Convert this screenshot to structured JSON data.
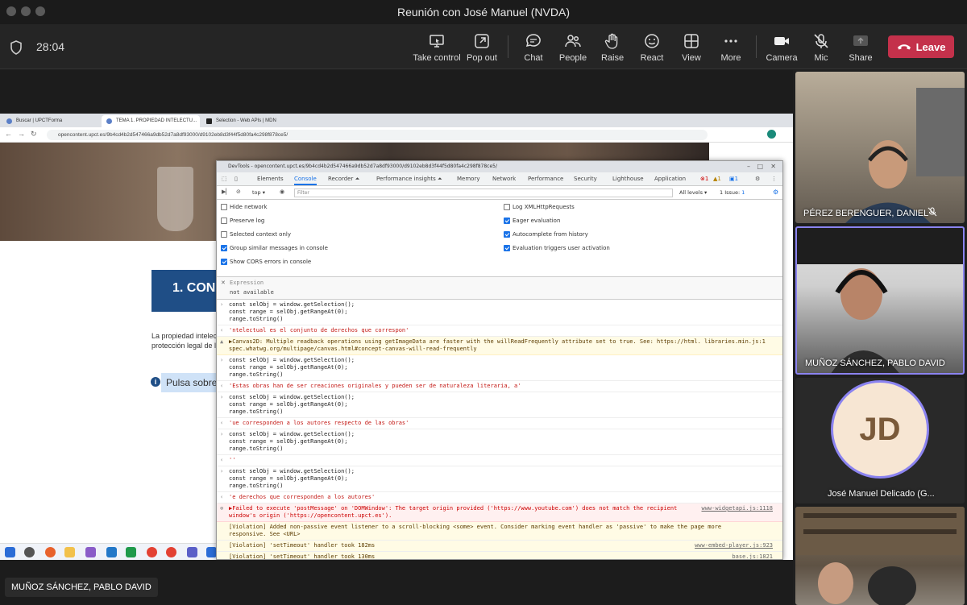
{
  "window": {
    "title": "Reunión con José Manuel (NVDA)"
  },
  "toolbar": {
    "timer": "28:04",
    "take_control": "Take control",
    "pop_out": "Pop out",
    "chat": "Chat",
    "people": "People",
    "raise": "Raise",
    "react": "React",
    "view": "View",
    "more": "More",
    "camera": "Camera",
    "mic": "Mic",
    "share": "Share",
    "leave": "Leave"
  },
  "browser": {
    "tabs": [
      "Buscar | UPCTForma",
      "TEMA 1. PROPIEDAD INTELECTU...",
      "Selection - Web APIs | MDN"
    ],
    "url": "opencontent.upct.es/9b4cd4b2d547466a9db52d7a8df93000/d9102eb8d3f44f5d80fa4c298f878ce5/"
  },
  "page": {
    "banner": "1. CON",
    "para_line1": "La propiedad intelect",
    "para_line2": "protección legal de las",
    "pulsa": "Pulsa sobre"
  },
  "devtools": {
    "title": "DevTools - opencontent.upct.es/9b4cd4b2d547466a9db52d7a8df93000/d9102eb8d3f44f5d80fa4c298f878ce5/",
    "tabs": [
      "Elements",
      "Console",
      "Recorder ⏶",
      "Performance insights ⏶",
      "Memory",
      "Network",
      "Performance",
      "Security",
      "Lighthouse",
      "Application"
    ],
    "badges": {
      "errors": "1",
      "warnings": "1",
      "info": "1"
    },
    "context": "top",
    "filter_placeholder": "Filter",
    "levels": "All levels",
    "issues": "1 Issue:",
    "issues_count": "1",
    "settings_left": [
      {
        "label": "Hide network",
        "checked": false
      },
      {
        "label": "Preserve log",
        "checked": false
      },
      {
        "label": "Selected context only",
        "checked": false
      },
      {
        "label": "Group similar messages in console",
        "checked": true
      },
      {
        "label": "Show CORS errors in console",
        "checked": true
      }
    ],
    "settings_right": [
      {
        "label": "Log XMLHttpRequests",
        "checked": false
      },
      {
        "label": "Eager evaluation",
        "checked": true
      },
      {
        "label": "Autocomplete from history",
        "checked": true
      },
      {
        "label": "Evaluation triggers user activation",
        "checked": true
      }
    ],
    "expression_label": "Expression",
    "expression_value": "not available",
    "console": [
      {
        "kind": "input",
        "text": "const selObj = window.getSelection();\nconst range = selObj.getRangeAt(0);\nrange.toString()"
      },
      {
        "kind": "result",
        "text": "'ntelectual es el conjunto de derechos que correspon'"
      },
      {
        "kind": "warn",
        "text": "▶Canvas2D: Multiple readback operations using getImageData are faster with the willReadFrequently attribute set to true. See: https://html. libraries.min.js:1\nspec.whatwg.org/multipage/canvas.html#concept-canvas-will-read-frequently",
        "src": ""
      },
      {
        "kind": "input",
        "text": "const selObj = window.getSelection();\nconst range = selObj.getRangeAt(0);\nrange.toString()"
      },
      {
        "kind": "result",
        "text": "'Estas obras han de ser creaciones originales y pueden ser de naturaleza literaria, a'"
      },
      {
        "kind": "input",
        "text": "const selObj = window.getSelection();\nconst range = selObj.getRangeAt(0);\nrange.toString()"
      },
      {
        "kind": "result",
        "text": "'ue corresponden a los autores respecto de las obras'"
      },
      {
        "kind": "input",
        "text": "const selObj = window.getSelection();\nconst range = selObj.getRangeAt(0);\nrange.toString()"
      },
      {
        "kind": "result",
        "text": "''"
      },
      {
        "kind": "input",
        "text": "const selObj = window.getSelection();\nconst range = selObj.getRangeAt(0);\nrange.toString()"
      },
      {
        "kind": "result",
        "text": "'e derechos que corresponden a los autores'"
      },
      {
        "kind": "err",
        "text": "▶Failed to execute 'postMessage' on 'DOMWindow': The target origin provided ('https://www.youtube.com') does not match the recipient\nwindow's origin ('https://opencontent.upct.es').",
        "src": "www-widgetapi.js:1118"
      },
      {
        "kind": "viol",
        "text": "[Violation] Added non-passive event listener to a scroll-blocking <some> event. Consider marking event handler as 'passive' to make the page more\nresponsive. See <URL>",
        "src": ""
      },
      {
        "kind": "viol",
        "text": "[Violation] 'setTimeout' handler took 182ms",
        "src": "www-embed-player.js:923"
      },
      {
        "kind": "viol",
        "text": "[Violation] 'setTimeout' handler took 130ms",
        "src": "base.js:1821"
      },
      {
        "kind": "highlight",
        "text": "const selObj = window.getSelection();\nconst range = selObj.getRangeAt(0);"
      }
    ]
  },
  "participants": [
    {
      "name": "PÉREZ BERENGUER, DANIEL"
    },
    {
      "name": "MUÑOZ SÁNCHEZ, PABLO DAVID"
    },
    {
      "name": "José Manuel Delicado (G...",
      "initials": "JD"
    },
    {
      "name": ""
    }
  ],
  "presenter": {
    "name": "MUÑOZ SÁNCHEZ, PABLO DAVID"
  },
  "colors": {
    "leave": "#c4314b",
    "accent": "#1a73e8",
    "avatar_ring": "#8b83f0",
    "avatar_bg": "#f7e6d3"
  }
}
